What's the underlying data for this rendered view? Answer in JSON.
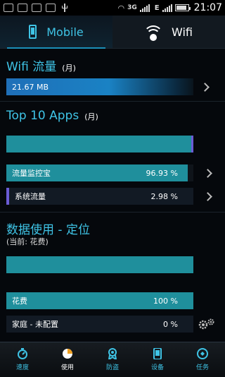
{
  "status_bar": {
    "network": "3G",
    "network2": "E",
    "time": "21:07"
  },
  "tabs": [
    {
      "label": "Mobile",
      "icon": "phone-icon",
      "active": true
    },
    {
      "label": "Wifi",
      "icon": "wifi-icon",
      "active": false
    }
  ],
  "wifi_section": {
    "title": "Wifi 流量",
    "period": "(月)",
    "value": "21.67 MB",
    "fill_fraction": 1.0
  },
  "top_apps": {
    "title": "Top 10 Apps",
    "period": "(月)",
    "items": [
      {
        "name": "流量监控宝",
        "percent": "96.93 %",
        "fraction": 0.9693
      },
      {
        "name": "系统流量",
        "percent": "2.98 %",
        "fraction": 0.0298
      }
    ]
  },
  "data_usage": {
    "title": "数据使用 - 定位",
    "current_note": "(当前: 花费)",
    "items": [
      {
        "name": "花费",
        "percent": "100 %",
        "fraction": 1.0
      },
      {
        "name": "家庭 - 未配置",
        "percent": "0 %",
        "fraction": 0.0
      }
    ]
  },
  "bottom_nav": [
    {
      "label": "速度",
      "icon": "speedometer-icon",
      "active": false
    },
    {
      "label": "使用",
      "icon": "pie-chart-icon",
      "active": true
    },
    {
      "label": "防盗",
      "icon": "badge-icon",
      "active": false
    },
    {
      "label": "设备",
      "icon": "device-icon",
      "active": false
    },
    {
      "label": "任务",
      "icon": "tasks-icon",
      "active": false
    }
  ],
  "colors": {
    "accent": "#3fc4e6",
    "bar_teal": "#1f8f9c",
    "bar_blue": "#1a6fb0",
    "marker_purple": "#6b5cd6"
  }
}
